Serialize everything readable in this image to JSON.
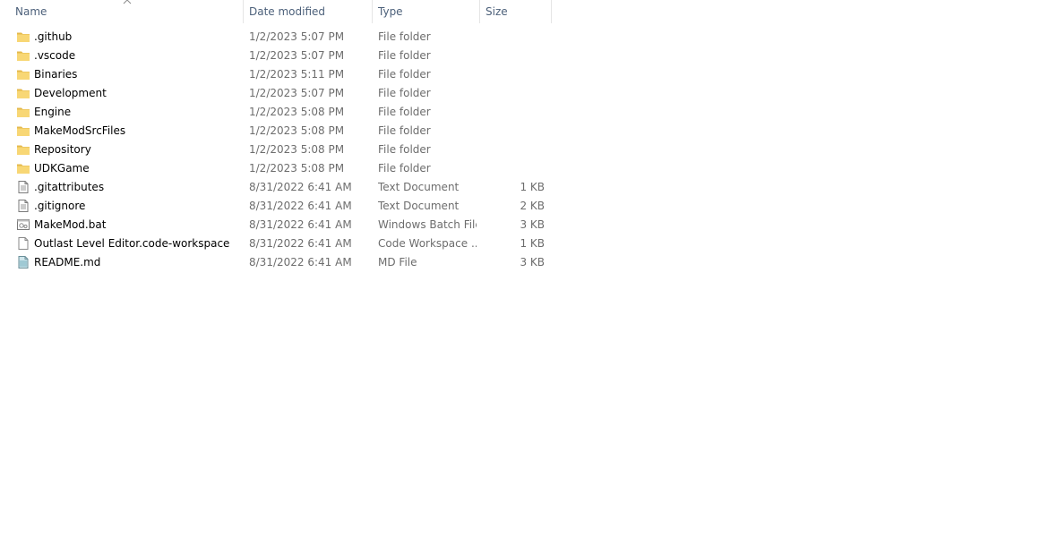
{
  "columns": {
    "name": "Name",
    "date_modified": "Date modified",
    "type": "Type",
    "size": "Size"
  },
  "files": [
    {
      "name": ".github",
      "date": "1/2/2023 5:07 PM",
      "type": "File folder",
      "size": "",
      "icon": "folder-icon"
    },
    {
      "name": ".vscode",
      "date": "1/2/2023 5:07 PM",
      "type": "File folder",
      "size": "",
      "icon": "folder-icon"
    },
    {
      "name": "Binaries",
      "date": "1/2/2023 5:11 PM",
      "type": "File folder",
      "size": "",
      "icon": "folder-icon"
    },
    {
      "name": "Development",
      "date": "1/2/2023 5:07 PM",
      "type": "File folder",
      "size": "",
      "icon": "folder-icon"
    },
    {
      "name": "Engine",
      "date": "1/2/2023 5:08 PM",
      "type": "File folder",
      "size": "",
      "icon": "folder-icon"
    },
    {
      "name": "MakeModSrcFiles",
      "date": "1/2/2023 5:08 PM",
      "type": "File folder",
      "size": "",
      "icon": "folder-icon"
    },
    {
      "name": "Repository",
      "date": "1/2/2023 5:08 PM",
      "type": "File folder",
      "size": "",
      "icon": "folder-icon"
    },
    {
      "name": "UDKGame",
      "date": "1/2/2023 5:08 PM",
      "type": "File folder",
      "size": "",
      "icon": "folder-icon"
    },
    {
      "name": ".gitattributes",
      "date": "8/31/2022 6:41 AM",
      "type": "Text Document",
      "size": "1 KB",
      "icon": "text-document-icon"
    },
    {
      "name": ".gitignore",
      "date": "8/31/2022 6:41 AM",
      "type": "Text Document",
      "size": "2 KB",
      "icon": "text-document-icon"
    },
    {
      "name": "MakeMod.bat",
      "date": "8/31/2022 6:41 AM",
      "type": "Windows Batch File",
      "size": "3 KB",
      "icon": "batch-file-icon"
    },
    {
      "name": "Outlast Level Editor.code-workspace",
      "date": "8/31/2022 6:41 AM",
      "type": "Code Workspace ...",
      "size": "1 KB",
      "icon": "blank-file-icon"
    },
    {
      "name": "README.md",
      "date": "8/31/2022 6:41 AM",
      "type": "MD File",
      "size": "3 KB",
      "icon": "md-file-icon"
    }
  ],
  "colors": {
    "header_text": "#4c607a",
    "secondary_text": "#6d6d6d",
    "folder": "#f8d775",
    "folder_dark": "#e4b94c"
  }
}
